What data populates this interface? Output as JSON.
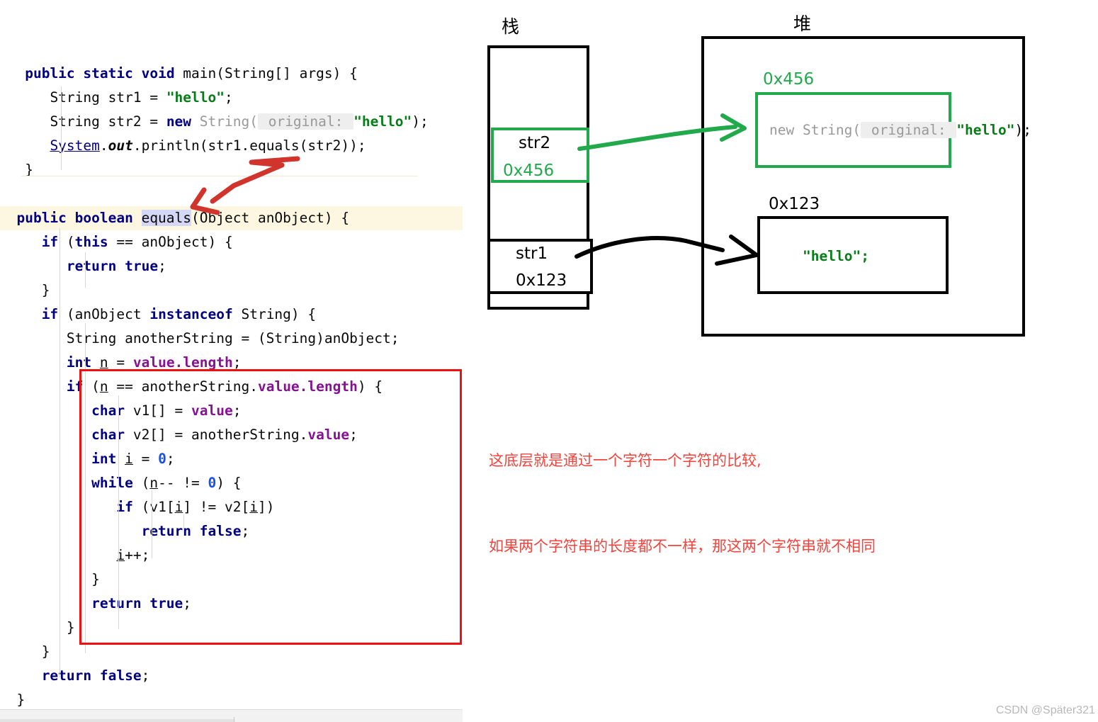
{
  "editor": {
    "lines": [
      {
        "indent": 3,
        "tokens": [
          {
            "t": "public ",
            "c": "kw"
          },
          {
            "t": "static ",
            "c": "kw"
          },
          {
            "t": "void ",
            "c": "kw"
          },
          {
            "t": "main(String[] args) {",
            "c": "plain"
          }
        ]
      },
      {
        "indent": 6,
        "tokens": [
          {
            "t": "String str1 = ",
            "c": "plain"
          },
          {
            "t": "\"hello\"",
            "c": "str"
          },
          {
            "t": ";",
            "c": "plain"
          }
        ]
      },
      {
        "indent": 6,
        "tokens": [
          {
            "t": "String str2 = ",
            "c": "plain"
          },
          {
            "t": "new ",
            "c": "kw"
          },
          {
            "t": "String(",
            "c": "grey"
          },
          {
            "t": " original: ",
            "c": "hintbg"
          },
          {
            "t": "\"hello\"",
            "c": "str"
          },
          {
            "t": ");",
            "c": "plain"
          }
        ]
      },
      {
        "indent": 6,
        "tokens": [
          {
            "t": "System",
            "c": "link"
          },
          {
            "t": ".",
            "c": "plain"
          },
          {
            "t": "out",
            "c": "ital"
          },
          {
            "t": ".println(str1.equals(str2));",
            "c": "plain"
          }
        ]
      },
      {
        "indent": 3,
        "tokens": [
          {
            "t": "}",
            "c": "plain"
          }
        ]
      },
      {
        "indent": 0,
        "tokens": []
      },
      {
        "indent": 2,
        "highlight": true,
        "tokens": [
          {
            "t": "public ",
            "c": "kw"
          },
          {
            "t": "boolean ",
            "c": "kw"
          },
          {
            "t": "equals",
            "c": "sel"
          },
          {
            "t": "(Object anObject) {",
            "c": "plain"
          }
        ]
      },
      {
        "indent": 5,
        "tokens": [
          {
            "t": "if ",
            "c": "kw"
          },
          {
            "t": "(",
            "c": "plain"
          },
          {
            "t": "this ",
            "c": "kw"
          },
          {
            "t": "== anObject) {",
            "c": "plain"
          }
        ]
      },
      {
        "indent": 8,
        "tokens": [
          {
            "t": "return ",
            "c": "kw"
          },
          {
            "t": "true",
            "c": "kw"
          },
          {
            "t": ";",
            "c": "plain"
          }
        ]
      },
      {
        "indent": 5,
        "tokens": [
          {
            "t": "}",
            "c": "plain"
          }
        ]
      },
      {
        "indent": 5,
        "tokens": [
          {
            "t": "if ",
            "c": "kw"
          },
          {
            "t": "(anObject ",
            "c": "plain"
          },
          {
            "t": "instanceof ",
            "c": "kw"
          },
          {
            "t": "String) {",
            "c": "plain"
          }
        ]
      },
      {
        "indent": 8,
        "tokens": [
          {
            "t": "String anotherString = (String)anObject;",
            "c": "plain"
          }
        ]
      },
      {
        "indent": 8,
        "tokens": [
          {
            "t": "int ",
            "c": "kw"
          },
          {
            "t": "n",
            "c": "uvar"
          },
          {
            "t": " = ",
            "c": "plain"
          },
          {
            "t": "value.length",
            "c": "field"
          },
          {
            "t": ";",
            "c": "plain"
          }
        ]
      },
      {
        "indent": 8,
        "tokens": [
          {
            "t": "if ",
            "c": "kw"
          },
          {
            "t": "(",
            "c": "plain"
          },
          {
            "t": "n",
            "c": "uvar"
          },
          {
            "t": " == anotherString.",
            "c": "plain"
          },
          {
            "t": "value.length",
            "c": "field"
          },
          {
            "t": ") {",
            "c": "plain"
          }
        ]
      },
      {
        "indent": 11,
        "tokens": [
          {
            "t": "char ",
            "c": "kw"
          },
          {
            "t": "v1[] = ",
            "c": "plain"
          },
          {
            "t": "value",
            "c": "field"
          },
          {
            "t": ";",
            "c": "plain"
          }
        ]
      },
      {
        "indent": 11,
        "tokens": [
          {
            "t": "char ",
            "c": "kw"
          },
          {
            "t": "v2[] = anotherString.",
            "c": "plain"
          },
          {
            "t": "value",
            "c": "field"
          },
          {
            "t": ";",
            "c": "plain"
          }
        ]
      },
      {
        "indent": 11,
        "tokens": [
          {
            "t": "int ",
            "c": "kw"
          },
          {
            "t": "i",
            "c": "uvar"
          },
          {
            "t": " = ",
            "c": "plain"
          },
          {
            "t": "0",
            "c": "num"
          },
          {
            "t": ";",
            "c": "plain"
          }
        ]
      },
      {
        "indent": 11,
        "tokens": [
          {
            "t": "while ",
            "c": "kw"
          },
          {
            "t": "(",
            "c": "plain"
          },
          {
            "t": "n",
            "c": "uvar"
          },
          {
            "t": "-- != ",
            "c": "plain"
          },
          {
            "t": "0",
            "c": "num"
          },
          {
            "t": ") {",
            "c": "plain"
          }
        ]
      },
      {
        "indent": 14,
        "tokens": [
          {
            "t": "if ",
            "c": "kw"
          },
          {
            "t": "(v1[",
            "c": "plain"
          },
          {
            "t": "i",
            "c": "uvar"
          },
          {
            "t": "] != v2[",
            "c": "plain"
          },
          {
            "t": "i",
            "c": "uvar"
          },
          {
            "t": "])",
            "c": "plain"
          }
        ]
      },
      {
        "indent": 17,
        "tokens": [
          {
            "t": "return ",
            "c": "kw"
          },
          {
            "t": "false",
            "c": "kw"
          },
          {
            "t": ";",
            "c": "plain"
          }
        ]
      },
      {
        "indent": 14,
        "tokens": [
          {
            "t": "i",
            "c": "uvar"
          },
          {
            "t": "++;",
            "c": "plain"
          }
        ]
      },
      {
        "indent": 11,
        "tokens": [
          {
            "t": "}",
            "c": "plain"
          }
        ]
      },
      {
        "indent": 11,
        "tokens": [
          {
            "t": "return ",
            "c": "kw"
          },
          {
            "t": "true",
            "c": "kw"
          },
          {
            "t": ";",
            "c": "plain"
          }
        ]
      },
      {
        "indent": 8,
        "tokens": [
          {
            "t": "}",
            "c": "plain"
          }
        ]
      },
      {
        "indent": 5,
        "tokens": [
          {
            "t": "}",
            "c": "plain"
          }
        ]
      },
      {
        "indent": 5,
        "tokens": [
          {
            "t": "return ",
            "c": "kw"
          },
          {
            "t": "false",
            "c": "kw"
          },
          {
            "t": ";",
            "c": "plain"
          }
        ]
      },
      {
        "indent": 2,
        "tokens": [
          {
            "t": "}",
            "c": "plain"
          }
        ]
      }
    ]
  },
  "diagram": {
    "stack_label": "栈",
    "heap_label": "堆",
    "stack_cells": [
      {
        "name": "str2",
        "address": "0x456",
        "highlight": "green"
      },
      {
        "name": "str1",
        "address": "0x123",
        "highlight": "black"
      }
    ],
    "heap_objects": [
      {
        "address": "0x456",
        "color": "green",
        "code_tokens": [
          {
            "t": "new ",
            "c": "grey"
          },
          {
            "t": "String(",
            "c": "grey"
          },
          {
            "t": " original: ",
            "c": "hintbg"
          },
          {
            "t": "\"hello\"",
            "c": "str"
          },
          {
            "t": ");",
            "c": "plain"
          }
        ]
      },
      {
        "address": "0x123",
        "color": "black",
        "code_tokens": [
          {
            "t": "\"hello\"",
            "c": "str"
          },
          {
            "t": ";",
            "c": "str"
          }
        ]
      }
    ]
  },
  "notes": {
    "line1": "这底层就是通过一个字符一个字符的比较,",
    "line2": "如果两个字符串的长度都不一样，那这两个字符串就不相同"
  },
  "watermark": "CSDN @Später321",
  "colors": {
    "keyword": "#000080",
    "string": "#067d17",
    "field": "#871094",
    "number": "#1750eb",
    "red_annotation": "#f4433c",
    "red_box": "#ee1111",
    "green_accent": "#22a94b",
    "row_highlight": "#fdf7e2",
    "selection": "#d4d7f5"
  }
}
